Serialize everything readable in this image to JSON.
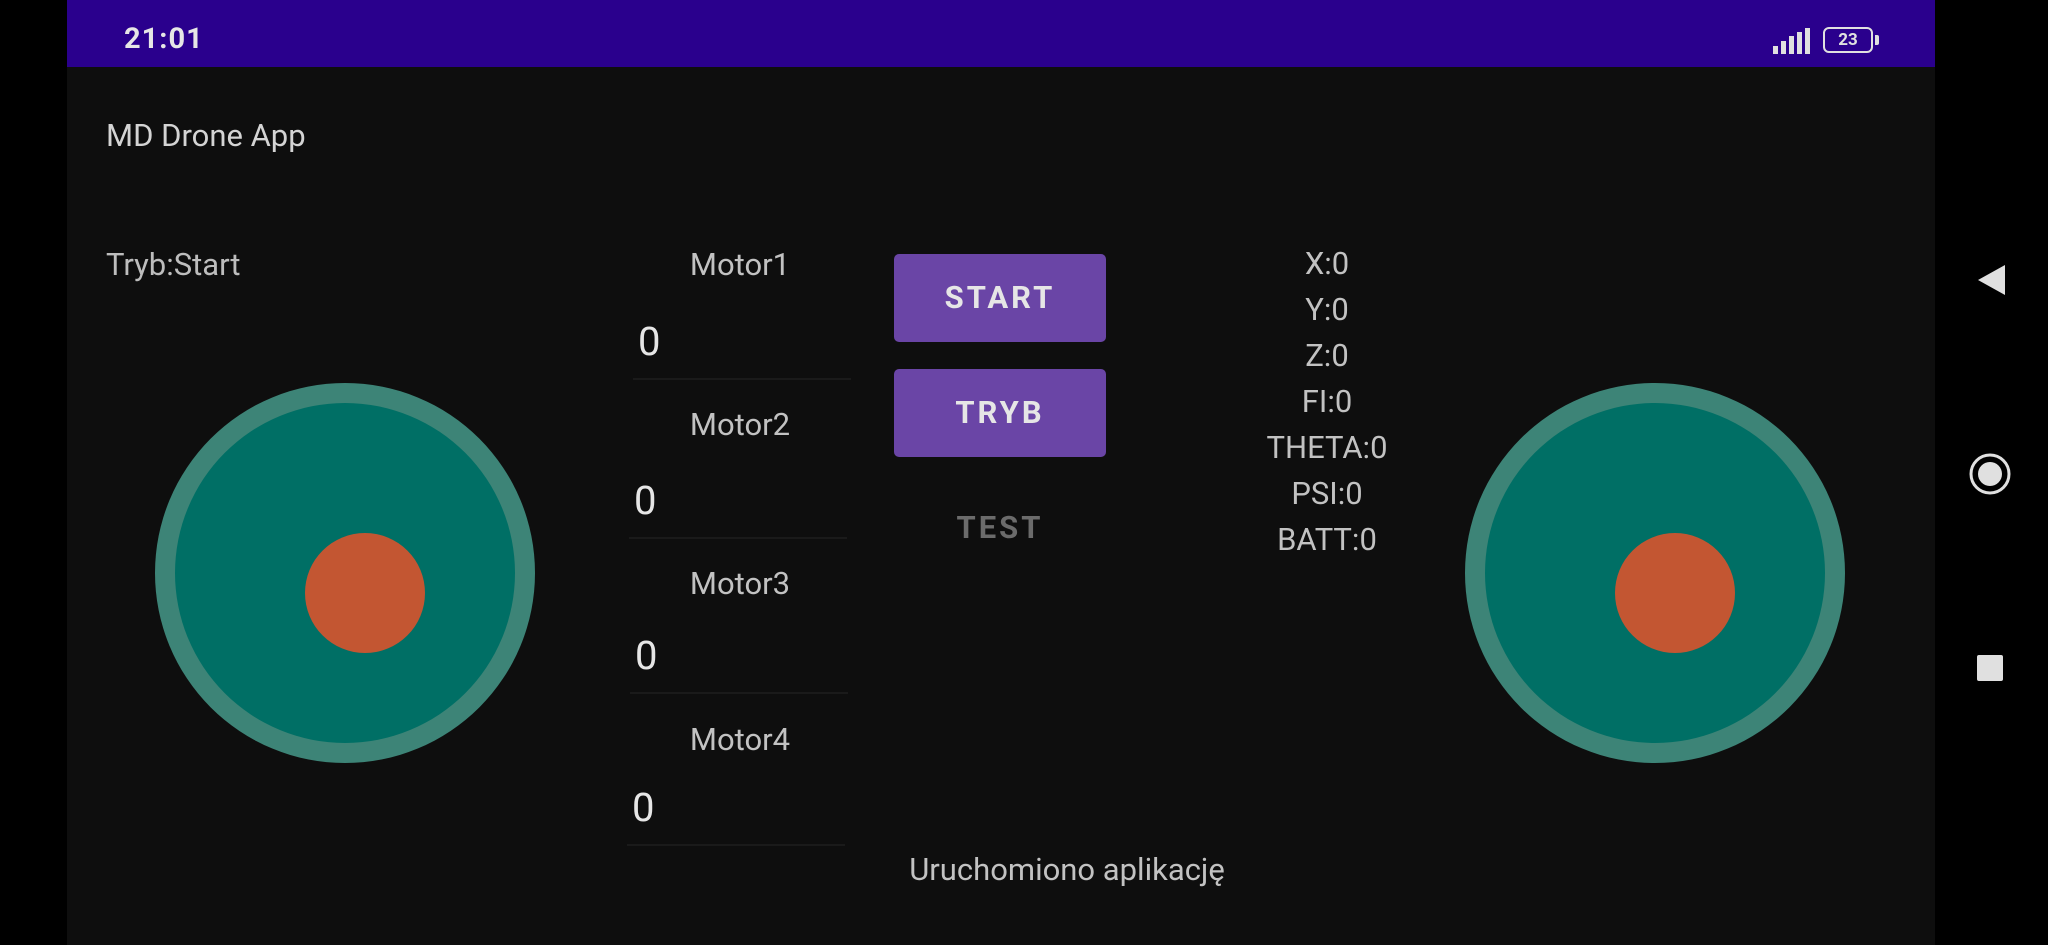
{
  "status_bar": {
    "time": "21:01",
    "battery_level": "23"
  },
  "app": {
    "title": "MD Drone App"
  },
  "mode": {
    "label": "Tryb:Start"
  },
  "motors": [
    {
      "label": "Motor1",
      "value": "0"
    },
    {
      "label": "Motor2",
      "value": "0"
    },
    {
      "label": "Motor3",
      "value": "0"
    },
    {
      "label": "Motor4",
      "value": "0"
    }
  ],
  "buttons": {
    "start": "START",
    "tryb": "TRYB",
    "test": "TEST"
  },
  "telemetry": [
    "X:0",
    "Y:0",
    "Z:0",
    "FI:0",
    "THETA:0",
    "PSI:0",
    "BATT:0"
  ],
  "log": "Uruchomiono aplikację",
  "icons": {
    "back": "back-icon",
    "home": "home-icon",
    "recents": "recents-icon",
    "signal": "signal-icon",
    "battery": "battery-icon"
  },
  "colors": {
    "status_bar": "#2a008d",
    "background": "#0e0e0e",
    "button": "#6a45a6",
    "joystick_ring": "#3d8477",
    "joystick_base": "#006f65",
    "joystick_knob": "#c35632"
  }
}
